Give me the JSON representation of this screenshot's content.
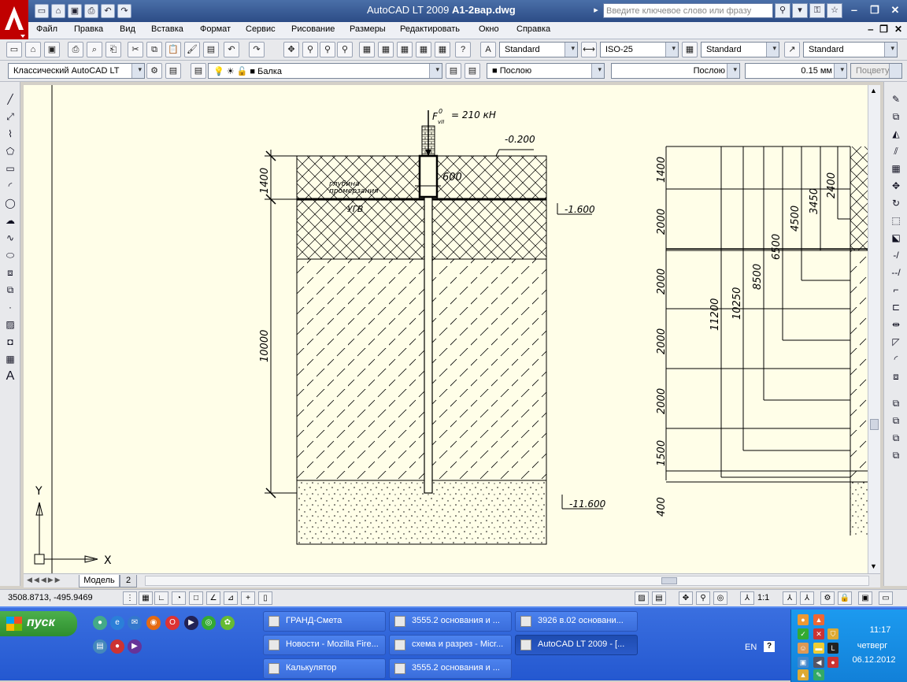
{
  "window": {
    "title_app": "AutoCAD LT 2009",
    "title_file": "A1-2вар.dwg",
    "search_placeholder": "Введите ключевое слово или фразу"
  },
  "menu": [
    "Файл",
    "Правка",
    "Вид",
    "Вставка",
    "Формат",
    "Сервис",
    "Рисование",
    "Размеры",
    "Редактировать",
    "Окно",
    "Справка"
  ],
  "toolbar1": {
    "text_style": "Standard",
    "dim_style": "ISO-25",
    "table_style": "Standard",
    "multileader_style": "Standard"
  },
  "toolbar2": {
    "workspace": "Классический AutoCAD LT",
    "layer": "Балка",
    "color": "Послою",
    "linetype": "Послою",
    "lineweight": "0.15 мм",
    "plotstyle": "Поцвету"
  },
  "drawing": {
    "load_symbol": "F",
    "load_sup": "0",
    "load_sub": "vII",
    "load_value": "= 210 кН",
    "level_top": "-0.200",
    "level_gw": "-1.600",
    "level_bottom": "-11.600",
    "dim_width": "600",
    "dim_1400": "1400",
    "dim_10000": "10000",
    "freeze_label_1": "глубина",
    "freeze_label_2": "промерзания",
    "gw_label": "УГВ",
    "right_dims_vertical": [
      "1400",
      "2000",
      "2000",
      "2000",
      "2000",
      "1500",
      "400"
    ],
    "right_dims_chain": [
      "11200",
      "10250",
      "8500",
      "6500",
      "4500",
      "3450",
      "2400"
    ],
    "ucs_y": "Y",
    "ucs_x": "X"
  },
  "tabs": {
    "model": "Модель",
    "layout": "2"
  },
  "status": {
    "coords": "3508.8713, -495.9469",
    "scale": "1:1"
  },
  "taskbar": {
    "start": "пуск",
    "tasks": [
      "ГРАНД-Смета",
      "3555.2 основания и ...",
      "3926 в.02 основани...",
      "Новости - Mozilla Fire...",
      "схема и разрез - Micr...",
      "AutoCAD LT 2009 - [...",
      "Калькулятор",
      "3555.2 основания и ..."
    ],
    "lang": "EN",
    "help": "?",
    "time": "11:17",
    "day": "четверг",
    "date": "06.12.2012"
  }
}
